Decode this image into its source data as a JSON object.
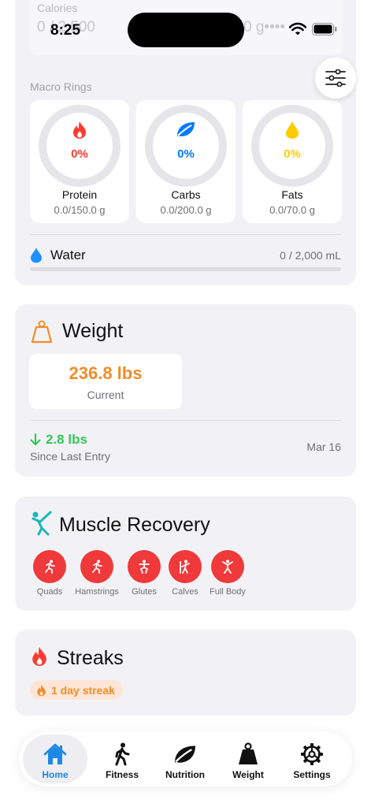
{
  "status_bar": {
    "time": "8:25"
  },
  "calories": {
    "label": "Calories",
    "value": "0 / 2,500",
    "right_value": "0 g••••"
  },
  "macros": {
    "title": "Macro Rings",
    "items": [
      {
        "name": "Protein",
        "percent_label": "0%",
        "amount": "0.0/150.0 g",
        "color": "#ff3b30",
        "icon": "flame-icon"
      },
      {
        "name": "Carbs",
        "percent_label": "0%",
        "amount": "0.0/200.0 g",
        "color": "#007aff",
        "icon": "leaf-icon"
      },
      {
        "name": "Fats",
        "percent_label": "0%",
        "amount": "0.0/70.0 g",
        "color": "#ffcc00",
        "icon": "drop-icon"
      }
    ]
  },
  "water": {
    "label": "Water",
    "value": "0 / 2,000 mL",
    "progress": 0,
    "color": "#1e90ff"
  },
  "weight": {
    "title": "Weight",
    "current_value": "236.8 lbs",
    "current_label": "Current",
    "change": "2.8 lbs",
    "change_label": "Since Last Entry",
    "date": "Mar 16",
    "accent": "#f28c28"
  },
  "muscle_recovery": {
    "title": "Muscle Recovery",
    "items": [
      {
        "label": "Quads"
      },
      {
        "label": "Hamstrings"
      },
      {
        "label": "Glutes"
      },
      {
        "label": "Calves"
      },
      {
        "label": "Full Body"
      }
    ]
  },
  "streaks": {
    "title": "Streaks",
    "badge": "1 day streak"
  },
  "tab_bar": {
    "tabs": [
      {
        "label": "Home",
        "icon": "house-icon",
        "active": true
      },
      {
        "label": "Fitness",
        "icon": "walking-figure-icon",
        "active": false
      },
      {
        "label": "Nutrition",
        "icon": "leaf-icon",
        "active": false
      },
      {
        "label": "Weight",
        "icon": "scale-weight-icon",
        "active": false
      },
      {
        "label": "Settings",
        "icon": "gear-icon",
        "active": false
      }
    ]
  }
}
